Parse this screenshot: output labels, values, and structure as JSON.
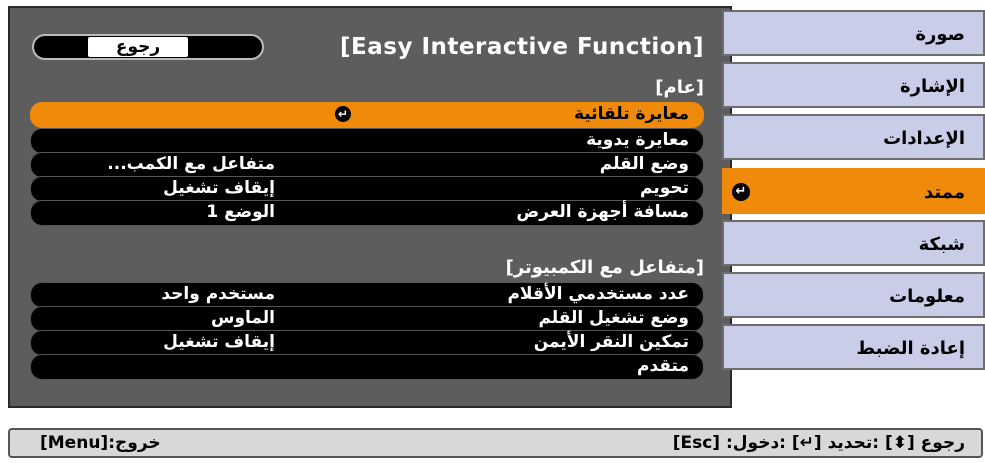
{
  "colors": {
    "panel": "#5d5d5d",
    "selected": "#f08a0a",
    "tab": "#c9cde8"
  },
  "header": {
    "title": "[Easy Interactive Function]",
    "back_label": "رجوع"
  },
  "section_general": {
    "title": "[عام]",
    "rows": [
      {
        "label": "معايرة تلقائية",
        "value": "",
        "enter_icon": "↵"
      },
      {
        "label": "معايرة يدوية",
        "value": ""
      },
      {
        "label": "وضع القلم",
        "value": "متفاعل مع الكمب..."
      },
      {
        "label": "تحويم",
        "value": "إيقاف تشغيل"
      },
      {
        "label": "مسافة أجهزة العرض",
        "value": "الوضع 1"
      }
    ]
  },
  "section_pc": {
    "title": "[متفاعل مع الكمبيوتر]",
    "rows": [
      {
        "label": "عدد مستخدمي الأقلام",
        "value": "مستخدم واحد"
      },
      {
        "label": "وضع تشغيل القلم",
        "value": "الماوس"
      },
      {
        "label": "تمكين النقر الأيمن",
        "value": "إيقاف تشغيل"
      },
      {
        "label": "متقدم",
        "value": ""
      }
    ]
  },
  "tabs": [
    {
      "label": "صورة"
    },
    {
      "label": "الإشارة"
    },
    {
      "label": "الإعدادات"
    },
    {
      "label": "ممتد",
      "enter_icon": "↵"
    },
    {
      "label": "شبكة"
    },
    {
      "label": "معلومات"
    },
    {
      "label": "إعادة الضبط"
    }
  ],
  "footer": {
    "left_hint": "[Menu]:خروج",
    "right_hint": "[Esc] :رجوع [⬍] :تحديد [↵] :دخول"
  }
}
